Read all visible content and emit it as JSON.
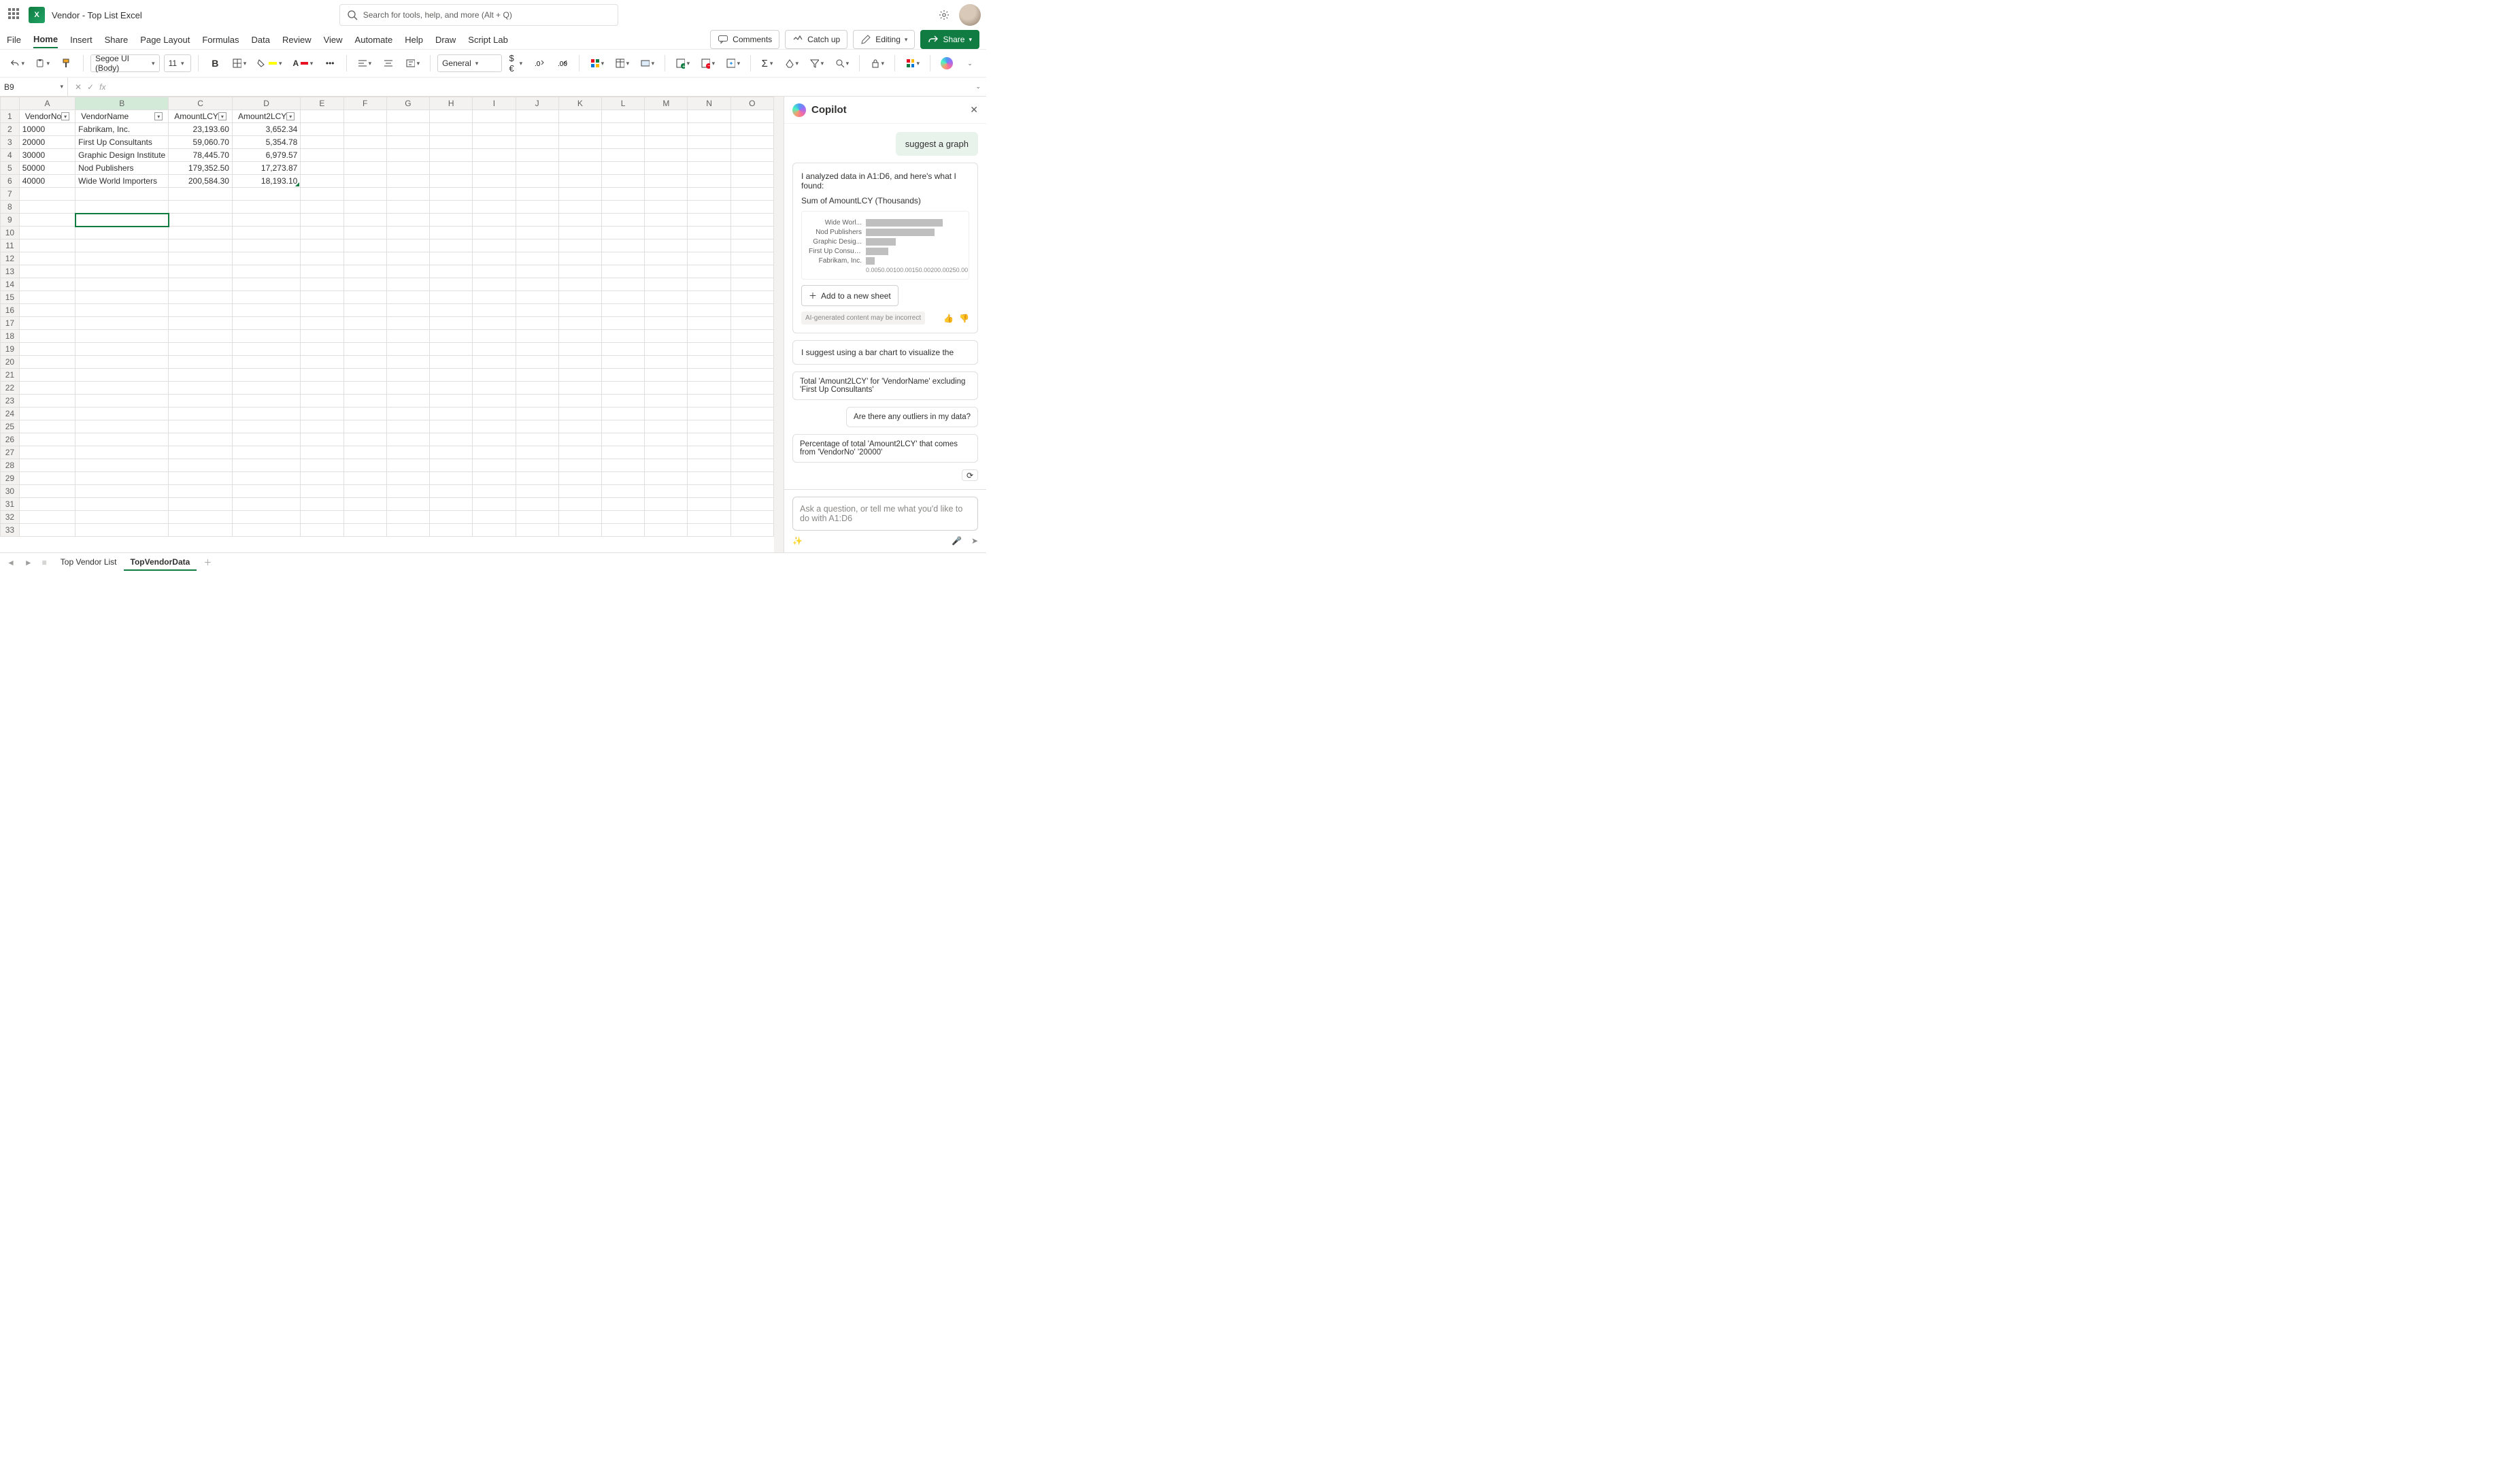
{
  "title": "Vendor - Top List Excel",
  "search_placeholder": "Search for tools, help, and more (Alt + Q)",
  "menu": [
    "File",
    "Home",
    "Insert",
    "Share",
    "Page Layout",
    "Formulas",
    "Data",
    "Review",
    "View",
    "Automate",
    "Help",
    "Draw",
    "Script Lab"
  ],
  "menu_active": "Home",
  "header_buttons": {
    "comments": "Comments",
    "catchup": "Catch up",
    "editing": "Editing",
    "share": "Share"
  },
  "ribbon": {
    "font": "Segoe UI (Body)",
    "size": "11",
    "number_format": "General"
  },
  "namebox": "B9",
  "columns": [
    "A",
    "B",
    "C",
    "D",
    "E",
    "F",
    "G",
    "H",
    "I",
    "J",
    "K",
    "L",
    "M",
    "N",
    "O"
  ],
  "col_classes": [
    "colA",
    "colB",
    "colC",
    "colD",
    "colgen",
    "colgen",
    "colgen",
    "colgen",
    "colgen",
    "colgen",
    "colgen",
    "colgen",
    "colgen",
    "colgen",
    "colgen"
  ],
  "selected_col_index": 1,
  "row_count": 33,
  "table_headers": [
    "VendorNo",
    "VendorName",
    "AmountLCY",
    "Amount2LCY"
  ],
  "rows": [
    {
      "r": 2,
      "cells": [
        "10000",
        "Fabrikam, Inc.",
        "23,193.60",
        "3,652.34"
      ]
    },
    {
      "r": 3,
      "cells": [
        "20000",
        "First Up Consultants",
        "59,060.70",
        "5,354.78"
      ]
    },
    {
      "r": 4,
      "cells": [
        "30000",
        "Graphic Design Institute",
        "78,445.70",
        "6,979.57"
      ]
    },
    {
      "r": 5,
      "cells": [
        "50000",
        "Nod Publishers",
        "179,352.50",
        "17,273.87"
      ]
    },
    {
      "r": 6,
      "cells": [
        "40000",
        "Wide World Importers",
        "200,584.30",
        "18,193.10"
      ]
    }
  ],
  "numeric_cols": [
    2,
    3
  ],
  "last_data_cell": {
    "row": 6,
    "col": 3
  },
  "selected_cell": {
    "row": 9,
    "col": 1
  },
  "sheet_tabs": [
    "Top Vendor List",
    "TopVendorData"
  ],
  "sheet_active": 1,
  "copilot": {
    "title": "Copilot",
    "user_msg": "suggest a graph",
    "analysis_line": "I analyzed data in A1:D6, and here's what I found:",
    "chart_title": "Sum of AmountLCY (Thousands)",
    "add_sheet": "Add to a new sheet",
    "disclaimer": "AI-generated content may be incorrect",
    "followup": "I suggest using a bar chart to visualize the",
    "sugg1": "Total 'Amount2LCY' for 'VendorName' excluding 'First Up Consultants'",
    "sugg2": "Are there any outliers in my data?",
    "sugg3": "Percentage of total 'Amount2LCY' that comes from 'VendorNo' '20000'",
    "ask_placeholder": "Ask a question, or tell me what you'd like to do with A1:D6"
  },
  "chart_data": {
    "type": "bar",
    "orientation": "horizontal",
    "title": "Sum of AmountLCY (Thousands)",
    "xlabel": "",
    "ylabel": "",
    "xlim": [
      0,
      250
    ],
    "x_ticks": [
      "0.00",
      "50.00",
      "100.00",
      "150.00",
      "200.00",
      "250.00"
    ],
    "categories": [
      "Wide Worl...",
      "Nod Publishers",
      "Graphic Desig...",
      "First Up Consultants",
      "Fabrikam, Inc."
    ],
    "values": [
      200.58,
      179.35,
      78.45,
      59.06,
      23.19
    ]
  }
}
